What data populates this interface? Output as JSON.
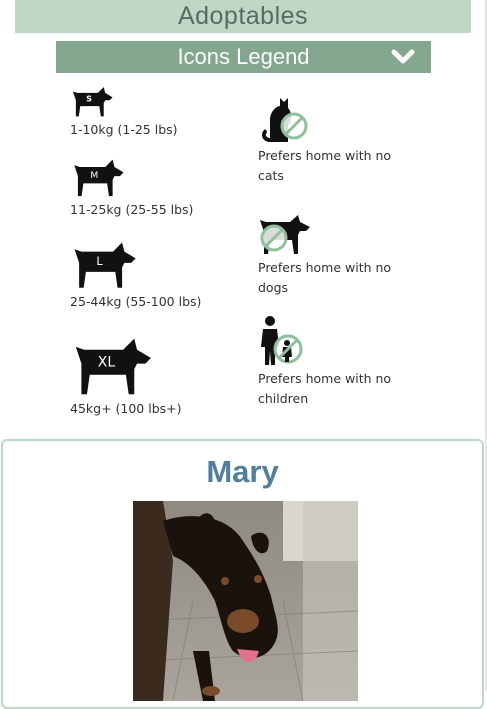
{
  "header": {
    "title": "Adoptables"
  },
  "legend": {
    "title": "Icons Legend",
    "toggle_icon": "chevron-down-icon",
    "items": [
      {
        "icon": "dog-small-icon",
        "badge": "S",
        "label": "1-10kg (1-25 lbs)"
      },
      {
        "icon": "dog-medium-icon",
        "badge": "M",
        "label": "11-25kg (25-55 lbs)"
      },
      {
        "icon": "dog-large-icon",
        "badge": "L",
        "label": "25-44kg (55-100 lbs)"
      },
      {
        "icon": "dog-xlarge-icon",
        "badge": "XL",
        "label": "45kg+ (100 lbs+)"
      },
      {
        "icon": "no-cats-icon",
        "label": "Prefers home with no cats"
      },
      {
        "icon": "no-dogs-icon",
        "label": "Prefers home with no dogs"
      },
      {
        "icon": "no-children-icon",
        "label": "Prefers home with no children"
      }
    ]
  },
  "pet": {
    "name": "Mary",
    "photo_icon": "dog-photo"
  },
  "colors": {
    "header_bg": "#bfd7c6",
    "legend_bg": "#82a78d",
    "name_color": "#4e7f9d",
    "no_symbol": "#8fc09c"
  }
}
